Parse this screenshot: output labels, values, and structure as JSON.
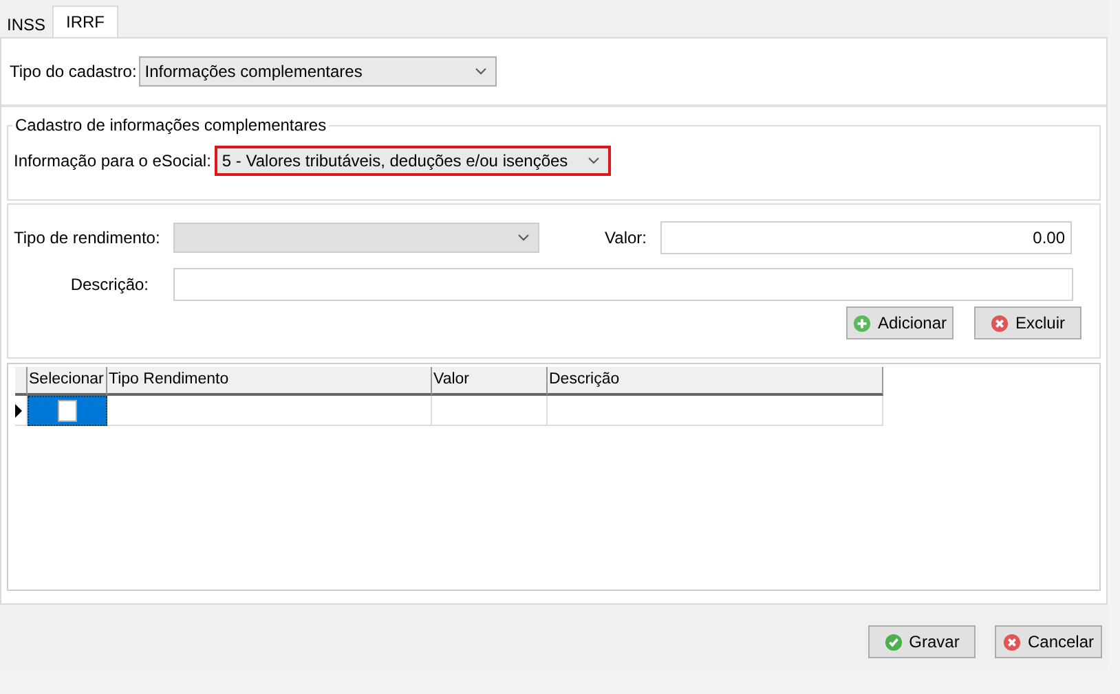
{
  "tabs": [
    {
      "label": "INSS",
      "selected": false
    },
    {
      "label": "IRRF",
      "selected": true
    }
  ],
  "tipo_cadastro": {
    "label": "Tipo do cadastro:",
    "value": "Informações complementares"
  },
  "group": {
    "title": "Cadastro de informações complementares",
    "label": "Informação para o eSocial:",
    "value": "5 - Valores tributáveis, deduções e/ou isenções",
    "highlighted": true
  },
  "form": {
    "tipo_label": "Tipo de rendimento:",
    "tipo_disabled": true,
    "valor_label": "Valor:",
    "valor_value": "0.00",
    "descricao_label": "Descrição:"
  },
  "form_buttons": [
    {
      "label": "Adicionar",
      "kind": "add"
    },
    {
      "label": "Excluir",
      "kind": "remove"
    }
  ],
  "grid": {
    "columns": [
      "Selecionar",
      "Tipo Rendimento",
      "Valor",
      "Descrição"
    ],
    "rows": [
      {
        "selected": true,
        "checked": false
      }
    ]
  },
  "footer_buttons": [
    {
      "label": "Gravar",
      "kind": "save"
    },
    {
      "label": "Cancelar",
      "kind": "cancel"
    }
  ]
}
